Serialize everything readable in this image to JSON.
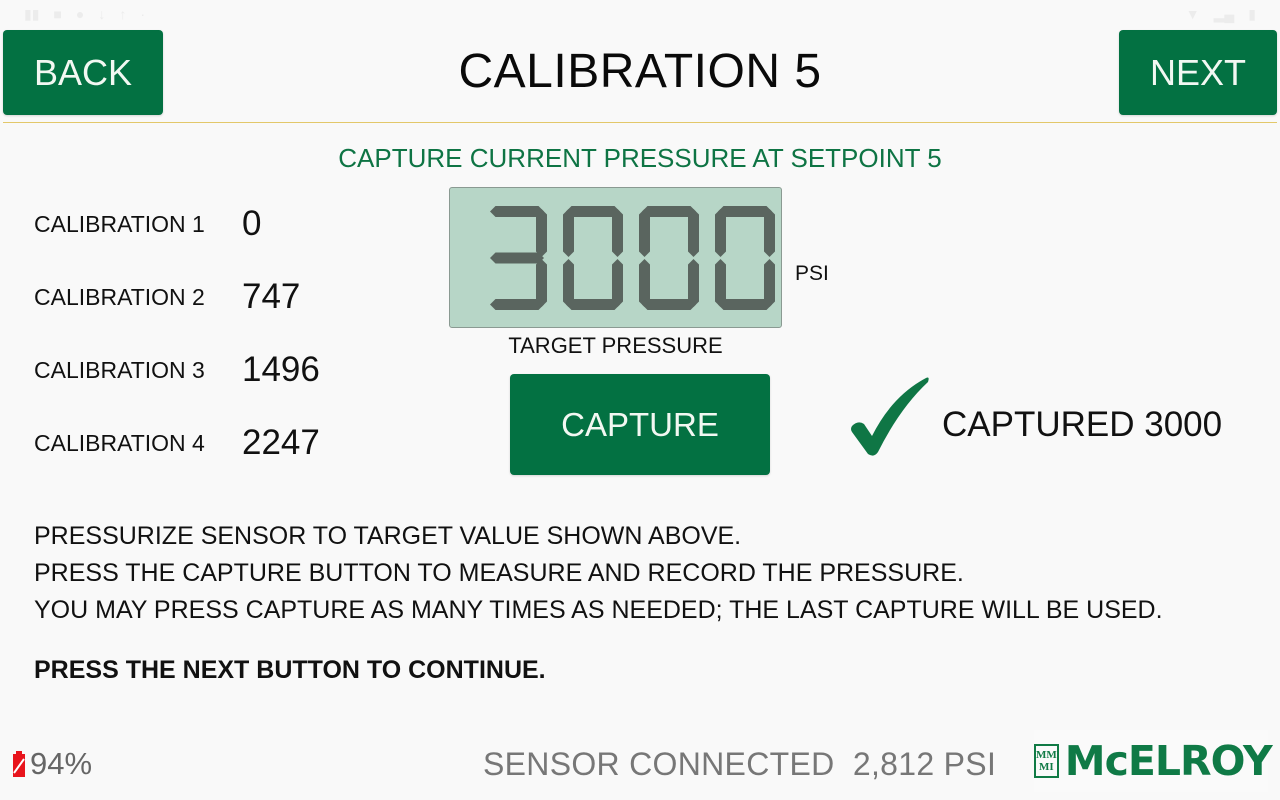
{
  "status_bar": {
    "left_icons": [
      "signal-icon",
      "message-icon",
      "chat-icon",
      "download-icon",
      "upload-icon",
      "dot-icon"
    ],
    "right_icons": [
      "wifi-icon",
      "signal-bars-icon",
      "battery-icon"
    ]
  },
  "header": {
    "back_label": "BACK",
    "title": "CALIBRATION 5",
    "next_label": "NEXT"
  },
  "subtitle": "CAPTURE CURRENT PRESSURE AT SETPOINT 5",
  "calibrations": [
    {
      "label": "CALIBRATION 1",
      "value": "0"
    },
    {
      "label": "CALIBRATION 2",
      "value": "747"
    },
    {
      "label": "CALIBRATION 3",
      "value": "1496"
    },
    {
      "label": "CALIBRATION 4",
      "value": "2247"
    }
  ],
  "display": {
    "target_value": "3000",
    "unit": "PSI",
    "label": "TARGET PRESSURE"
  },
  "capture": {
    "button_label": "CAPTURE",
    "status_icon": "check-icon",
    "status_text": "CAPTURED 3000"
  },
  "instructions": {
    "lines": [
      "PRESSURIZE SENSOR TO TARGET VALUE SHOWN ABOVE.",
      "PRESS THE CAPTURE BUTTON TO MEASURE AND RECORD THE PRESSURE.",
      "YOU MAY PRESS CAPTURE AS MANY TIMES AS NEEDED; THE LAST CAPTURE WILL BE USED."
    ],
    "bold_line": "PRESS THE NEXT BUTTON TO CONTINUE."
  },
  "footer": {
    "battery_percent": "94%",
    "sensor_status": "SENSOR CONNECTED  2,812 PSI",
    "logo_mark_top": "MM",
    "logo_mark_bottom": "MI",
    "logo_text": "McELROY"
  },
  "colors": {
    "brand_green": "#037142",
    "subtitle_green": "#0e7444",
    "lcd_background": "#b7d6c7",
    "lcd_segment": "#5a655f",
    "battery_red": "#e8141c",
    "divider_gold": "#e3c86a"
  }
}
